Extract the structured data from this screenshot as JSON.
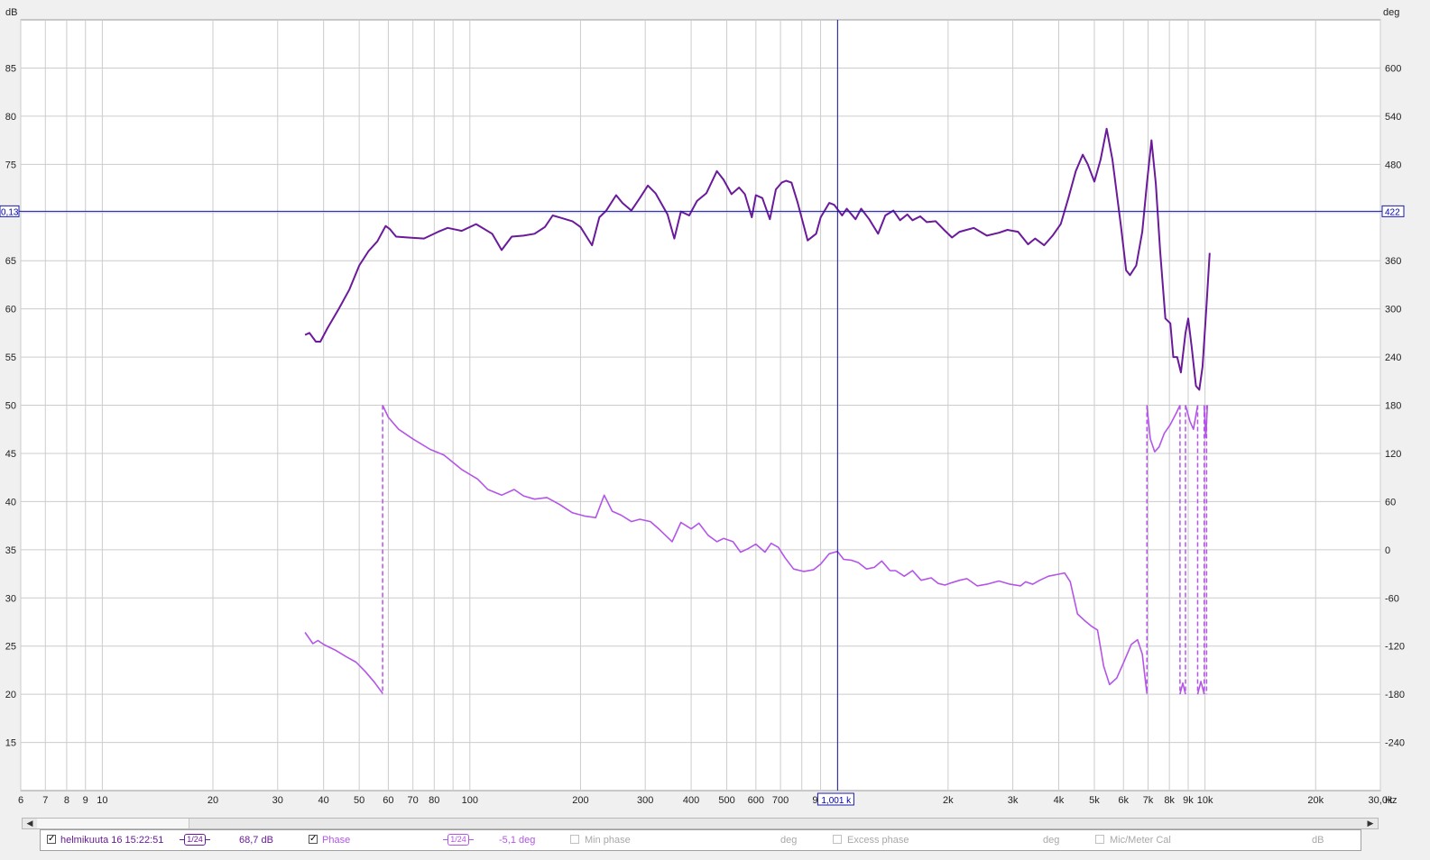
{
  "colors": {
    "spl": "#6a1a9a",
    "phase": "#b455e8",
    "cursor": "#1a1aa8",
    "grid": "#cccccc",
    "plot_bg": "#ffffff"
  },
  "cursor": {
    "freq_label": "1,001 k",
    "left_label": "0,13",
    "right_label": "422",
    "freq_hz": 1001,
    "level_db": 70.13
  },
  "legend": {
    "measurement_name": "helmikuuta 16 15:22:51",
    "spl_smoothing": "1/24",
    "spl_value": "68,7 dB",
    "phase_label": "Phase",
    "phase_smoothing": "1/24",
    "phase_value": "-5,1 deg",
    "min_phase_label": "Min phase",
    "min_phase_unit": "deg",
    "excess_phase_label": "Excess phase",
    "excess_phase_unit": "deg",
    "mic_cal_label": "Mic/Meter Cal",
    "mic_cal_unit": "dB",
    "checkbox_on": "✓"
  },
  "scrollbar": {
    "left_arrow": "◀",
    "right_arrow": "▶"
  },
  "chart_data": {
    "type": "line",
    "xscale": "log",
    "xlim": [
      6,
      30000
    ],
    "ylim": [
      10,
      90
    ],
    "y2lim": [
      -300,
      660
    ],
    "ylabel": "dB",
    "y2label": "deg",
    "xunit": "Hz",
    "yticks": [
      15,
      20,
      25,
      30,
      35,
      40,
      45,
      50,
      55,
      60,
      65,
      70,
      75,
      80,
      85
    ],
    "y2ticks": [
      -240,
      -180,
      -120,
      -60,
      0,
      60,
      120,
      180,
      240,
      300,
      360,
      420,
      480,
      540,
      600
    ],
    "xticks": [
      {
        "v": 6,
        "l": "6"
      },
      {
        "v": 7,
        "l": "7"
      },
      {
        "v": 8,
        "l": "8"
      },
      {
        "v": 9,
        "l": "9"
      },
      {
        "v": 10,
        "l": "10"
      },
      {
        "v": 20,
        "l": "20"
      },
      {
        "v": 30,
        "l": "30"
      },
      {
        "v": 40,
        "l": "40"
      },
      {
        "v": 50,
        "l": "50"
      },
      {
        "v": 60,
        "l": "60"
      },
      {
        "v": 70,
        "l": "70"
      },
      {
        "v": 80,
        "l": "80"
      },
      {
        "v": 100,
        "l": "100"
      },
      {
        "v": 200,
        "l": "200"
      },
      {
        "v": 300,
        "l": "300"
      },
      {
        "v": 400,
        "l": "400"
      },
      {
        "v": 500,
        "l": "500"
      },
      {
        "v": 600,
        "l": "600"
      },
      {
        "v": 700,
        "l": "700"
      },
      {
        "v": 900,
        "l": "90"
      },
      {
        "v": 2000,
        "l": "2k"
      },
      {
        "v": 3000,
        "l": "3k"
      },
      {
        "v": 4000,
        "l": "4k"
      },
      {
        "v": 5000,
        "l": "5k"
      },
      {
        "v": 6000,
        "l": "6k"
      },
      {
        "v": 7000,
        "l": "7k"
      },
      {
        "v": 8000,
        "l": "8k"
      },
      {
        "v": 9000,
        "l": "9k"
      },
      {
        "v": 10000,
        "l": "10k"
      },
      {
        "v": 20000,
        "l": "20k"
      },
      {
        "v": 30000,
        "l": "30,0k"
      }
    ],
    "grid": true,
    "series": [
      {
        "axis": "left",
        "color": "#6a1a9a",
        "points": [
          [
            35.6,
            57.3
          ],
          [
            36.6,
            57.5
          ],
          [
            38.1,
            56.6
          ],
          [
            39.2,
            56.6
          ],
          [
            41,
            58
          ],
          [
            44,
            60
          ],
          [
            47,
            62
          ],
          [
            50,
            64.5
          ],
          [
            53,
            66
          ],
          [
            56,
            67
          ],
          [
            59,
            68.6
          ],
          [
            60.5,
            68.3
          ],
          [
            63,
            67.5
          ],
          [
            68,
            67.4
          ],
          [
            75,
            67.3
          ],
          [
            82,
            68
          ],
          [
            87,
            68.4
          ],
          [
            95,
            68.1
          ],
          [
            104,
            68.8
          ],
          [
            115,
            67.8
          ],
          [
            122,
            66.1
          ],
          [
            130,
            67.5
          ],
          [
            140,
            67.6
          ],
          [
            150,
            67.8
          ],
          [
            160,
            68.5
          ],
          [
            168,
            69.7
          ],
          [
            175,
            69.5
          ],
          [
            190,
            69.1
          ],
          [
            200,
            68.5
          ],
          [
            215,
            66.6
          ],
          [
            225,
            69.5
          ],
          [
            235,
            70.2
          ],
          [
            250,
            71.8
          ],
          [
            260,
            71
          ],
          [
            275,
            70.2
          ],
          [
            290,
            71.5
          ],
          [
            305,
            72.8
          ],
          [
            320,
            72
          ],
          [
            345,
            69.8
          ],
          [
            360,
            67.3
          ],
          [
            375,
            70.1
          ],
          [
            395,
            69.7
          ],
          [
            415,
            71.2
          ],
          [
            440,
            72
          ],
          [
            470,
            74.3
          ],
          [
            490,
            73.4
          ],
          [
            515,
            71.9
          ],
          [
            540,
            72.6
          ],
          [
            560,
            71.9
          ],
          [
            585,
            69.5
          ],
          [
            600,
            71.8
          ],
          [
            625,
            71.5
          ],
          [
            655,
            69.3
          ],
          [
            680,
            72.4
          ],
          [
            705,
            73.1
          ],
          [
            725,
            73.3
          ],
          [
            750,
            73.1
          ],
          [
            780,
            71
          ],
          [
            830,
            67.1
          ],
          [
            875,
            67.8
          ],
          [
            900,
            69.5
          ],
          [
            950,
            71
          ],
          [
            980,
            70.8
          ],
          [
            1030,
            69.7
          ],
          [
            1060,
            70.4
          ],
          [
            1120,
            69.3
          ],
          [
            1160,
            70.4
          ],
          [
            1220,
            69.3
          ],
          [
            1290,
            67.8
          ],
          [
            1350,
            69.7
          ],
          [
            1420,
            70.2
          ],
          [
            1480,
            69.2
          ],
          [
            1550,
            69.8
          ],
          [
            1600,
            69.2
          ],
          [
            1680,
            69.6
          ],
          [
            1750,
            69
          ],
          [
            1850,
            69.1
          ],
          [
            1950,
            68.2
          ],
          [
            2050,
            67.4
          ],
          [
            2150,
            68
          ],
          [
            2350,
            68.4
          ],
          [
            2550,
            67.6
          ],
          [
            2750,
            67.9
          ],
          [
            2900,
            68.2
          ],
          [
            3100,
            68
          ],
          [
            3300,
            66.7
          ],
          [
            3450,
            67.3
          ],
          [
            3650,
            66.6
          ],
          [
            3850,
            67.6
          ],
          [
            4050,
            68.8
          ],
          [
            4250,
            71.5
          ],
          [
            4450,
            74.3
          ],
          [
            4650,
            76
          ],
          [
            4800,
            75
          ],
          [
            5000,
            73.2
          ],
          [
            5200,
            75.5
          ],
          [
            5400,
            78.7
          ],
          [
            5600,
            75.5
          ],
          [
            5900,
            68.7
          ],
          [
            6100,
            64
          ],
          [
            6250,
            63.5
          ],
          [
            6500,
            64.5
          ],
          [
            6750,
            68
          ],
          [
            6950,
            73
          ],
          [
            7150,
            77.5
          ],
          [
            7350,
            73
          ],
          [
            7550,
            66
          ],
          [
            7800,
            59
          ],
          [
            8050,
            58.5
          ],
          [
            8200,
            55
          ],
          [
            8400,
            55
          ],
          [
            8600,
            53.4
          ],
          [
            8850,
            57.5
          ],
          [
            9000,
            59
          ],
          [
            9200,
            56
          ],
          [
            9450,
            52
          ],
          [
            9650,
            51.6
          ],
          [
            9850,
            54
          ],
          [
            10100,
            60.5
          ],
          [
            10300,
            65.8
          ]
        ]
      },
      {
        "axis": "right",
        "color": "#b455e8",
        "points": [
          [
            35.6,
            -103
          ],
          [
            37.4,
            -117
          ],
          [
            38.6,
            -113
          ],
          [
            40,
            -118
          ],
          [
            43,
            -125
          ],
          [
            46,
            -133
          ],
          [
            49,
            -140
          ],
          [
            52,
            -152
          ],
          [
            55,
            -165
          ],
          [
            57.9,
            -179
          ],
          [
            57.9,
            180
          ],
          [
            60,
            165
          ],
          [
            64,
            150
          ],
          [
            70,
            138
          ],
          [
            78,
            125
          ],
          [
            85,
            118
          ],
          [
            95,
            100
          ],
          [
            105,
            88
          ],
          [
            112,
            75
          ],
          [
            122,
            68
          ],
          [
            132,
            75
          ],
          [
            140,
            67
          ],
          [
            150,
            63
          ],
          [
            162,
            65
          ],
          [
            176,
            56
          ],
          [
            190,
            46
          ],
          [
            205,
            42
          ],
          [
            220,
            40
          ],
          [
            232,
            68
          ],
          [
            244,
            48
          ],
          [
            258,
            43
          ],
          [
            275,
            35
          ],
          [
            290,
            38
          ],
          [
            310,
            35
          ],
          [
            330,
            24
          ],
          [
            355,
            10
          ],
          [
            375,
            34
          ],
          [
            400,
            26
          ],
          [
            420,
            33
          ],
          [
            445,
            18
          ],
          [
            470,
            10
          ],
          [
            490,
            14
          ],
          [
            520,
            10
          ],
          [
            545,
            -3
          ],
          [
            570,
            1
          ],
          [
            600,
            7
          ],
          [
            635,
            -3
          ],
          [
            660,
            8
          ],
          [
            690,
            3
          ],
          [
            720,
            -10
          ],
          [
            760,
            -24
          ],
          [
            810,
            -27
          ],
          [
            860,
            -25
          ],
          [
            900,
            -18
          ],
          [
            950,
            -5
          ],
          [
            1000,
            -2
          ],
          [
            1040,
            -12
          ],
          [
            1090,
            -13
          ],
          [
            1140,
            -16
          ],
          [
            1200,
            -24
          ],
          [
            1260,
            -22
          ],
          [
            1320,
            -14
          ],
          [
            1390,
            -26
          ],
          [
            1440,
            -26
          ],
          [
            1520,
            -33
          ],
          [
            1600,
            -26
          ],
          [
            1690,
            -38
          ],
          [
            1800,
            -35
          ],
          [
            1880,
            -42
          ],
          [
            1960,
            -44
          ],
          [
            2050,
            -41
          ],
          [
            2150,
            -38
          ],
          [
            2250,
            -36
          ],
          [
            2400,
            -45
          ],
          [
            2550,
            -43
          ],
          [
            2750,
            -39
          ],
          [
            2950,
            -43
          ],
          [
            3150,
            -45
          ],
          [
            3250,
            -40
          ],
          [
            3400,
            -43
          ],
          [
            3550,
            -38
          ],
          [
            3750,
            -33
          ],
          [
            3950,
            -31
          ],
          [
            4150,
            -29
          ],
          [
            4300,
            -40
          ],
          [
            4500,
            -80
          ],
          [
            4700,
            -88
          ],
          [
            4900,
            -95
          ],
          [
            5100,
            -100
          ],
          [
            5300,
            -145
          ],
          [
            5500,
            -168
          ],
          [
            5750,
            -160
          ],
          [
            6000,
            -141
          ],
          [
            6300,
            -118
          ],
          [
            6550,
            -112
          ],
          [
            6750,
            -130
          ],
          [
            6950,
            -179
          ],
          [
            6950,
            180
          ],
          [
            7100,
            138
          ],
          [
            7300,
            122
          ],
          [
            7500,
            128
          ],
          [
            7750,
            145
          ],
          [
            8050,
            156
          ],
          [
            8350,
            170
          ],
          [
            8550,
            180
          ],
          [
            8550,
            -180
          ],
          [
            8700,
            -166
          ],
          [
            8850,
            -180
          ],
          [
            8850,
            180
          ],
          [
            9100,
            160
          ],
          [
            9300,
            150
          ],
          [
            9550,
            180
          ],
          [
            9550,
            -180
          ],
          [
            9750,
            -164
          ],
          [
            9950,
            -180
          ],
          [
            9950,
            180
          ],
          [
            10050,
            140
          ],
          [
            10150,
            180
          ]
        ],
        "dashed_jumps": [
          57.9,
          6950,
          8550,
          8850,
          9550,
          9950,
          10100
        ]
      }
    ]
  }
}
